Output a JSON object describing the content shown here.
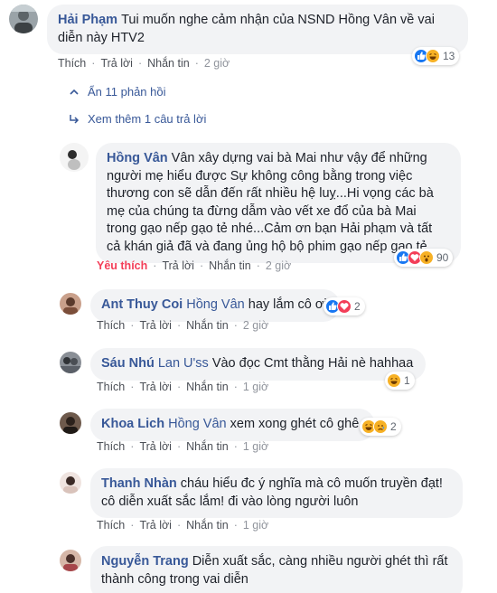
{
  "comments": [
    {
      "id": "c1",
      "author": "Hải Phạm",
      "text": "Tui muốn nghe cảm nhận của NSND Hồng Vân về vai diễn này HTV2",
      "actions": {
        "like": "Thích",
        "reply": "Trả lời",
        "message": "Nhắn tin",
        "time": "2 giờ"
      },
      "reactions": [
        "like",
        "haha"
      ],
      "reaction_count": "13"
    },
    {
      "id": "c2",
      "author": "Hồng Vân",
      "text": "Vân xây dựng vai bà Mai như vậy để những người mẹ hiểu được Sự không công bằng trong việc thương con sẽ dẫn đến rất nhiều hệ luỵ...Hi vọng các bà mẹ của chúng ta đừng dẫm vào vết xe đổ của bà Mai trong gạo nếp gạo tẻ nhé...Cảm ơn bạn Hải phạm và tất cả khán giả đã và đang ủng hộ bộ phim gạo nếp gạo tẻ",
      "actions": {
        "like": "Yêu thích",
        "reply": "Trả lời",
        "message": "Nhắn tin",
        "time": "2 giờ"
      },
      "reactions": [
        "like",
        "love",
        "wow"
      ],
      "reaction_count": "90"
    },
    {
      "id": "c3",
      "author": "Ant Thuy Coi",
      "tag": "Hồng Vân",
      "text": "hay lắm cô ơi",
      "actions": {
        "like": "Thích",
        "reply": "Trả lời",
        "message": "Nhắn tin",
        "time": "2 giờ"
      },
      "reactions": [
        "like",
        "love"
      ],
      "reaction_count": "2"
    },
    {
      "id": "c4",
      "author": "Sáu Nhú",
      "tag": "Lan U'ss",
      "text": "Vào đọc Cmt thằng Hải nè hahhaa",
      "actions": {
        "like": "Thích",
        "reply": "Trả lời",
        "message": "Nhắn tin",
        "time": "1 giờ"
      },
      "reactions": [
        "haha"
      ],
      "reaction_count": "1"
    },
    {
      "id": "c5",
      "author": "Khoa Lich",
      "tag": "Hồng Vân",
      "text": "xem xong ghét cô ghê.",
      "actions": {
        "like": "Thích",
        "reply": "Trả lời",
        "message": "Nhắn tin",
        "time": "1 giờ"
      },
      "reactions": [
        "haha",
        "sad"
      ],
      "reaction_count": "2"
    },
    {
      "id": "c6",
      "author": "Thanh Nhàn",
      "text": "cháu hiểu đc ý nghĩa mà cô muốn truyền đạt! cô diễn xuất sắc lắm! đi vào lòng người luôn",
      "actions": {
        "like": "Thích",
        "reply": "Trả lời",
        "message": "Nhắn tin",
        "time": "1 giờ"
      }
    },
    {
      "id": "c7",
      "author": "Nguyễn Trang",
      "text": "Diễn xuất sắc, càng nhiều người ghét thì rất thành công trong vai diễn"
    }
  ],
  "links": {
    "hide_replies": "Ẩn 11 phản hồi",
    "more_replies": "Xem thêm 1 câu trả lời"
  },
  "icons": {
    "hide": "chevron-up-icon",
    "more": "reply-arrow-icon",
    "like": "like-reaction-icon",
    "love": "love-reaction-icon",
    "haha": "haha-reaction-icon",
    "wow": "wow-reaction-icon",
    "sad": "sad-reaction-icon"
  },
  "colors": {
    "author": "#385898",
    "bubble": "#f2f3f5",
    "liked": "#f33e58",
    "like_blue": "#1877f2"
  }
}
